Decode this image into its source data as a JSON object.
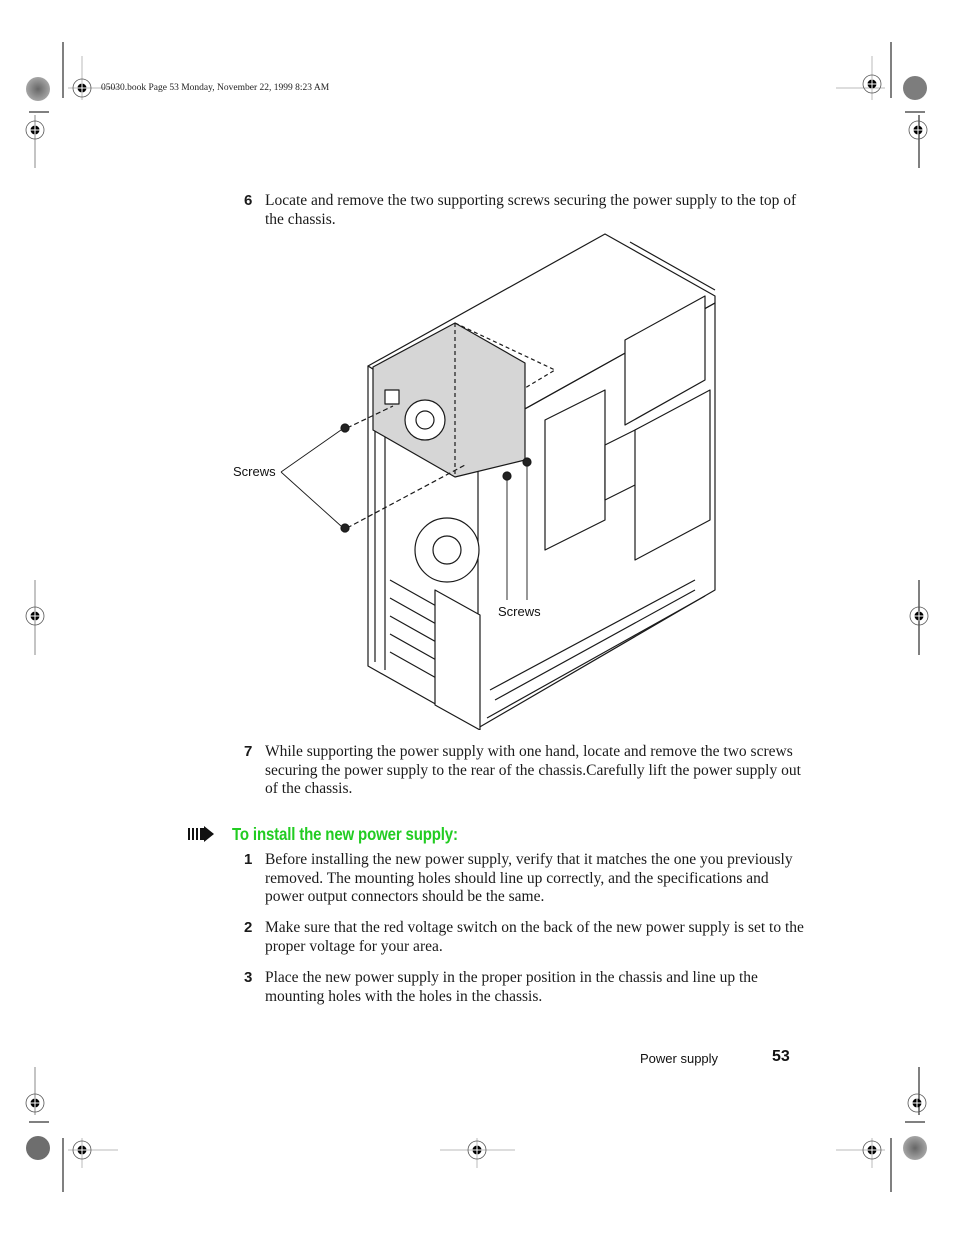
{
  "slug": {
    "text": "05030.book  Page 53  Monday, November 22, 1999  8:23 AM"
  },
  "steps_remove": [
    {
      "number": "6",
      "text": "Locate and remove the two supporting screws securing the power supply to the top of the chassis."
    },
    {
      "number": "7",
      "text": "While supporting the power supply with one hand, locate and remove the two screws securing the power supply to the rear of the chassis.Carefully lift the power supply out of the chassis."
    }
  ],
  "figure": {
    "callouts": [
      {
        "label": "Screws"
      },
      {
        "label": "Screws"
      }
    ],
    "colors": {
      "power_supply_fill": "#d6d6d6",
      "line": "#1a1a1a"
    }
  },
  "procedure": {
    "icon": "procedure-arrow-icon",
    "title": "To install the new power supply:",
    "title_color": "#22cc22"
  },
  "steps_install": [
    {
      "number": "1",
      "text": "Before installing the new power supply, verify that it matches the one you previously removed. The mounting holes should line up correctly, and the specifications and power output connectors should be the same."
    },
    {
      "number": "2",
      "text": "Make sure that the red voltage switch on the back of the new power supply is set to the proper voltage for your area."
    },
    {
      "number": "3",
      "text": "Place the new power supply in the proper position in the chassis and line up the mounting holes with the holes in the chassis."
    }
  ],
  "footer": {
    "section": "Power supply",
    "page_number": "53"
  }
}
